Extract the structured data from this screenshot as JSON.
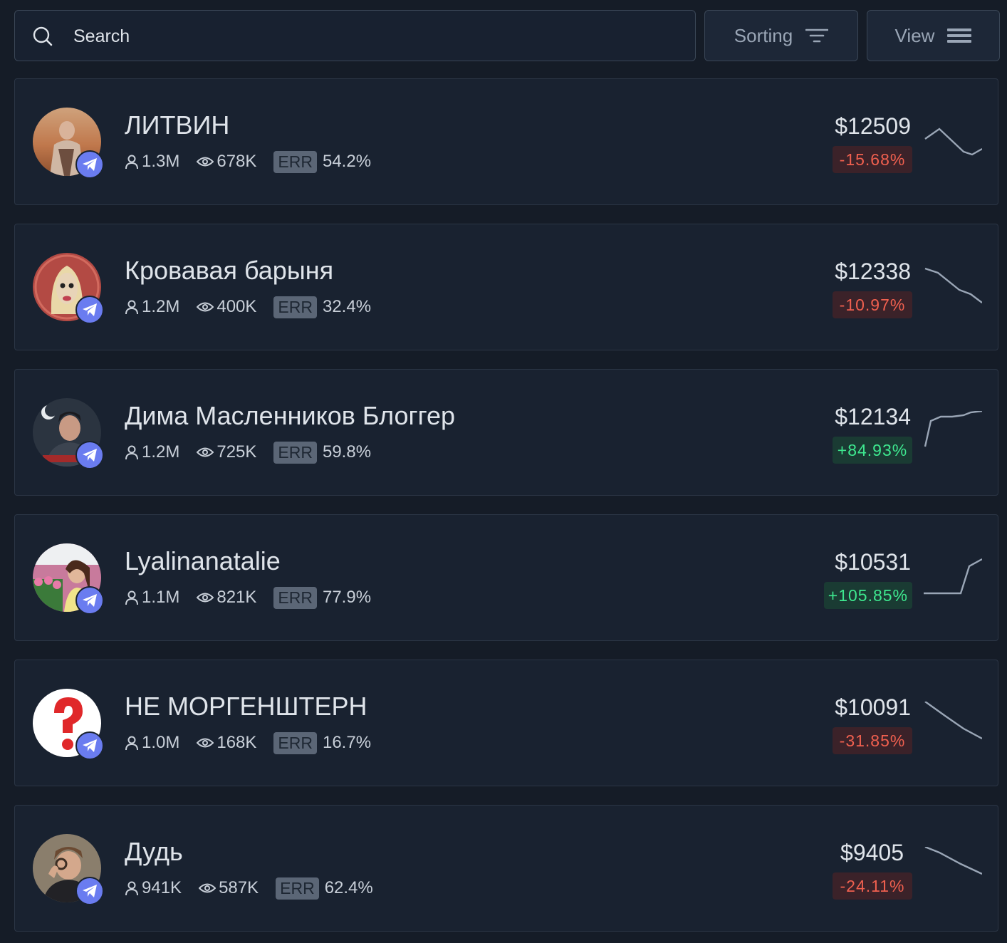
{
  "search": {
    "placeholder": "Search",
    "value": ""
  },
  "toolbar": {
    "sorting_label": "Sorting",
    "view_label": "View"
  },
  "colors": {
    "negative": "#f0604f",
    "positive": "#3ee88f",
    "telegram_badge": "#6a7cf0",
    "sparkline": "#9aa6b6"
  },
  "channels": [
    {
      "name": "ЛИТВИН",
      "subscribers": "1.3M",
      "views": "678K",
      "err_label": "ERR",
      "err": "54.2%",
      "price": "$12509",
      "change": "-15.68%",
      "trend": "negative",
      "platform_icon": "telegram-icon"
    },
    {
      "name": "Кровавая барыня",
      "subscribers": "1.2M",
      "views": "400K",
      "err_label": "ERR",
      "err": "32.4%",
      "price": "$12338",
      "change": "-10.97%",
      "trend": "negative",
      "platform_icon": "telegram-icon"
    },
    {
      "name": "Дима Масленников Блоггер",
      "subscribers": "1.2M",
      "views": "725K",
      "err_label": "ERR",
      "err": "59.8%",
      "price": "$12134",
      "change": "+84.93%",
      "trend": "positive",
      "platform_icon": "telegram-icon"
    },
    {
      "name": "Lyalinanatalie",
      "subscribers": "1.1M",
      "views": "821K",
      "err_label": "ERR",
      "err": "77.9%",
      "price": "$10531",
      "change": "+105.85%",
      "trend": "positive",
      "platform_icon": "telegram-icon"
    },
    {
      "name": "НЕ МОРГЕНШТЕРН",
      "subscribers": "1.0M",
      "views": "168K",
      "err_label": "ERR",
      "err": "16.7%",
      "price": "$10091",
      "change": "-31.85%",
      "trend": "negative",
      "platform_icon": "telegram-icon"
    },
    {
      "name": "Дудь",
      "subscribers": "941K",
      "views": "587K",
      "err_label": "ERR",
      "err": "62.4%",
      "price": "$9405",
      "change": "-24.11%",
      "trend": "negative",
      "platform_icon": "telegram-icon"
    }
  ]
}
